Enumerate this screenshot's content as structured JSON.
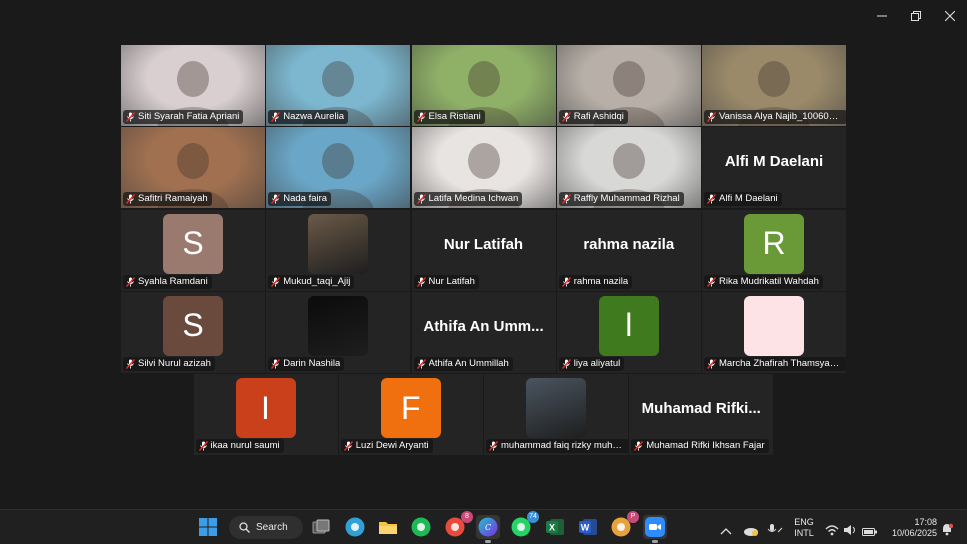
{
  "window_controls": {
    "minimize": "—",
    "restore": "❐",
    "close": "✕"
  },
  "participants": [
    {
      "name": "Siti Syarah Fatia Apriani",
      "type": "video",
      "tone": "#d9cfd0"
    },
    {
      "name": "Nazwa Aurelia",
      "type": "video",
      "tone": "#7cb7cf",
      "active": true
    },
    {
      "name": "Elsa Ristiani",
      "type": "video",
      "tone": "#8fb067"
    },
    {
      "name": "Rafi Ashidqi",
      "type": "video",
      "tone": "#b8b0a8"
    },
    {
      "name": "Vanissa Alya Najib_1006012...",
      "type": "video",
      "tone": "#9a8a6a"
    },
    {
      "name": "Safitri Ramaiyah",
      "type": "video",
      "tone": "#a07050"
    },
    {
      "name": "Nada faira",
      "type": "video",
      "tone": "#6aa6c7"
    },
    {
      "name": "Latifa Medina Ichwan",
      "type": "video",
      "tone": "#e8e4e2"
    },
    {
      "name": "Raffly Muhammad Rizhal",
      "type": "video",
      "tone": "#d8d8d6"
    },
    {
      "name": "Alfi M Daelani",
      "type": "bigname",
      "display": "Alfi M Daelani"
    },
    {
      "name": "Syahla Ramdani",
      "type": "avatar",
      "initial": "S",
      "color": "#9a7a6e"
    },
    {
      "name": "Mukud_taqi_Ajij",
      "type": "photo",
      "tone": "#6b5a48"
    },
    {
      "name": "Nur Latifah",
      "type": "bigname",
      "display": "Nur Latifah"
    },
    {
      "name": "rahma nazila",
      "type": "bigname",
      "display": "rahma nazila"
    },
    {
      "name": "Rika Mudrikatil Wahdah",
      "type": "avatar",
      "initial": "R",
      "color": "#6a9a38"
    },
    {
      "name": "Silvi Nurul azizah",
      "type": "avatar",
      "initial": "S",
      "color": "#6b4a3e"
    },
    {
      "name": "Darin Nashila",
      "type": "photo",
      "tone": "#0b0b0b"
    },
    {
      "name": "Athifa An Ummillah",
      "type": "bigname",
      "display": "Athifa An Umm..."
    },
    {
      "name": "liya aliyatul",
      "type": "avatar",
      "initial": "l",
      "color": "#3f7a1e"
    },
    {
      "name": "Marcha Zhafirah Thamsyah ...",
      "type": "avatar",
      "initial": "",
      "color": "#fde2e6"
    },
    {
      "name": "ikaa nurul saumi",
      "type": "avatar",
      "initial": "I",
      "color": "#c9401a"
    },
    {
      "name": "Luzi Dewi Aryanti",
      "type": "avatar",
      "initial": "F",
      "color": "#f07010"
    },
    {
      "name": "muhammad faiq rizky muha...",
      "type": "photo",
      "tone": "#4a5560"
    },
    {
      "name": "Muhamad Rifki Ikhsan Fajar",
      "type": "bigname",
      "display": "Muhamad Rifki..."
    }
  ],
  "taskbar": {
    "search_label": "Search",
    "apps": [
      {
        "name": "windows-start-icon",
        "color": "#3b9de8"
      },
      {
        "name": "task-view-icon",
        "color": "#888"
      },
      {
        "name": "edge-icon",
        "color": "#2fa1d8"
      },
      {
        "name": "file-explorer-icon",
        "color": "#f5c342"
      },
      {
        "name": "spotify-icon",
        "color": "#1db954"
      },
      {
        "name": "chrome-icon",
        "color": "#e84a3c",
        "badge": "8"
      },
      {
        "name": "canva-icon",
        "color": "#7d4ce0",
        "active": true
      },
      {
        "name": "whatsapp-icon",
        "color": "#25d366",
        "badge": "74"
      },
      {
        "name": "excel-icon",
        "color": "#1d7a44"
      },
      {
        "name": "word-icon",
        "color": "#2b5cc7"
      },
      {
        "name": "chrome-profile-icon",
        "color": "#e8a23c",
        "badge": "P"
      },
      {
        "name": "zoom-icon",
        "color": "#2d8cff",
        "active": true
      }
    ],
    "tray": {
      "lang_top": "ENG",
      "lang_bottom": "INTL",
      "time": "17:08",
      "date": "10/06/2025"
    }
  }
}
